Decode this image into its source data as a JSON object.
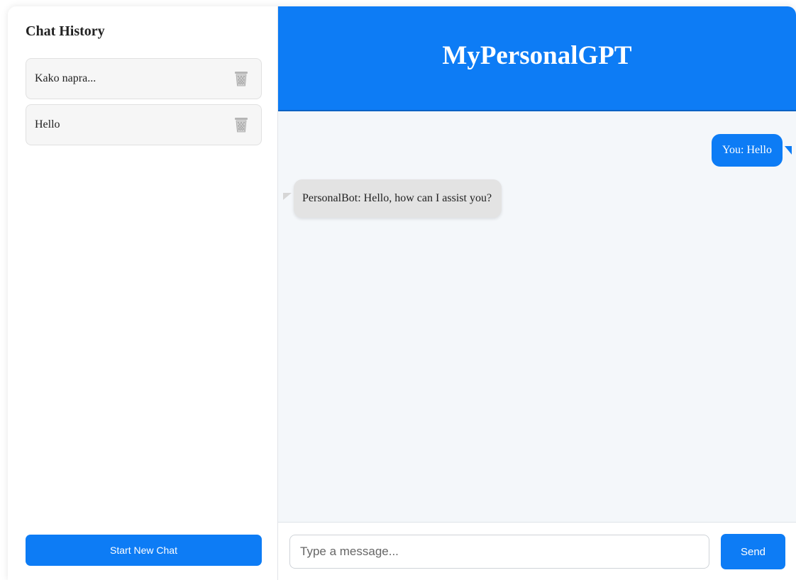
{
  "sidebar": {
    "title": "Chat History",
    "history": [
      {
        "label": "Kako napra...",
        "icon": "trash-icon"
      },
      {
        "label": "Hello",
        "icon": "trash-icon"
      }
    ],
    "new_chat_label": "Start New Chat"
  },
  "header": {
    "title": "MyPersonalGPT"
  },
  "messages": [
    {
      "sender": "user",
      "text": "You: Hello"
    },
    {
      "sender": "bot",
      "text": "PersonalBot: Hello, how can I assist you?"
    }
  ],
  "composer": {
    "placeholder": "Type a message...",
    "value": "",
    "send_label": "Send"
  },
  "colors": {
    "accent": "#0d7cf5",
    "bot_bubble": "#e3e3e3",
    "chat_background": "#f4f7fa"
  }
}
